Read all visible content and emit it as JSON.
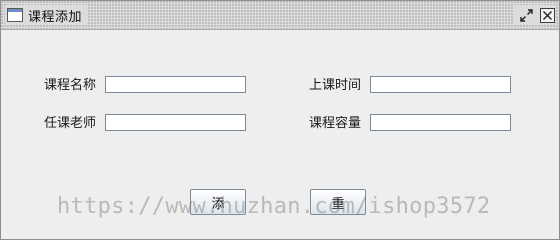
{
  "window": {
    "title": "课程添加",
    "icon": "window-app-icon",
    "controls": [
      "restore-icon",
      "close-icon"
    ]
  },
  "form": {
    "course_name_label": "课程名称",
    "course_name_value": "",
    "class_time_label": "上课时间",
    "class_time_value": "",
    "teacher_label": "任课老师",
    "teacher_value": "",
    "capacity_label": "课程容量",
    "capacity_value": ""
  },
  "buttons": {
    "add_label": "添",
    "reset_label": "重"
  },
  "watermark": {
    "text": "https://www.huzhan.com/ishop3572"
  }
}
